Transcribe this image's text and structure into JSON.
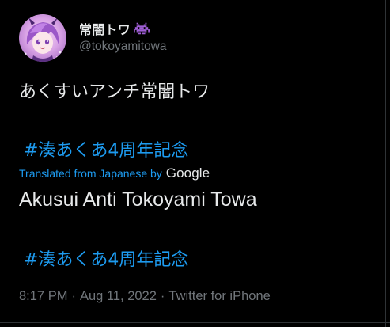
{
  "author": {
    "display_name": "常闇トワ",
    "badge_icon": "space-invader-icon",
    "handle": "@tokoyamitowa",
    "avatar": "avatar-icon"
  },
  "tweet": {
    "text": "あくすいアンチ常闇トワ",
    "hashtag_original": "#湊あくあ4周年記念",
    "translated_label": "Translated from Japanese by",
    "translator": "Google",
    "translation": "Akusui Anti Tokoyami Towa",
    "hashtag_translated": "#湊あくあ4周年記念"
  },
  "meta": {
    "time": "8:17 PM",
    "separator": "·",
    "date": "Aug 11, 2022",
    "source": "Twitter for iPhone"
  },
  "colors": {
    "background": "#000000",
    "text": "#e7e9ea",
    "secondary": "#71767b",
    "accent": "#1d9bf0",
    "badge": "#a05fd6"
  }
}
